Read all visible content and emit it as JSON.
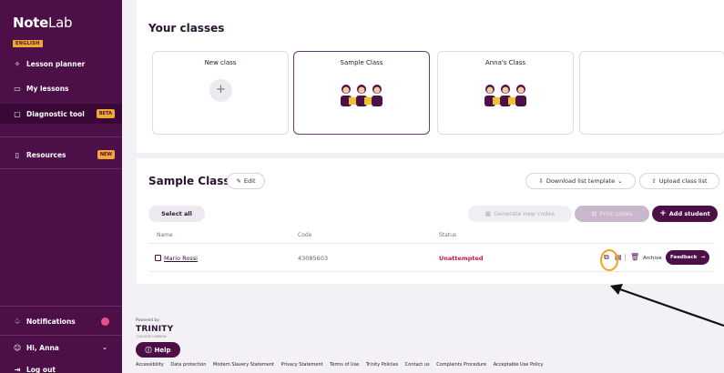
{
  "sidebar": {
    "logo": {
      "main": "Note",
      "light": "Lab",
      "badge": "ENGLISH"
    },
    "items": [
      {
        "label": "Lesson planner",
        "icon": "sparkle-icon"
      },
      {
        "label": "My lessons",
        "icon": "book-icon"
      },
      {
        "label": "Diagnostic tool",
        "icon": "chat-icon",
        "badge": "BETA",
        "active": true
      },
      {
        "label": "Resources",
        "icon": "book-open-icon",
        "badge": "NEW"
      }
    ],
    "bottom": [
      {
        "label": "Notifications",
        "icon": "bell-icon"
      },
      {
        "label": "Hi, Anna",
        "icon": "user-icon"
      },
      {
        "label": "Log out",
        "icon": "logout-icon"
      }
    ]
  },
  "classes": {
    "title": "Your classes",
    "cards": [
      {
        "label": "New class"
      },
      {
        "label": "Sample Class",
        "selected": true
      },
      {
        "label": "Anna's Class"
      },
      {
        "label": ""
      }
    ]
  },
  "class_panel": {
    "title": "Sample Class",
    "edit_label": "Edit",
    "download_label": "Download list template",
    "upload_label": "Upload class list",
    "select_all": "Select all",
    "generate_codes": "Generate new codes",
    "print_codes": "Print codes",
    "add_student": "Add student",
    "columns": [
      "Name",
      "Code",
      "Status"
    ],
    "rows": [
      {
        "name": "Mario Rossi",
        "code": "43085603",
        "status": "Unattempted",
        "archive": "Archive",
        "feedback": "Feedback"
      }
    ]
  },
  "footer": {
    "powered_by": "Powered by",
    "brand": "TRINITY",
    "brand_sub": "COLLEGE LONDON",
    "help": "Help",
    "links": [
      "Accessibility",
      "Data protection",
      "Modern Slavery Statement",
      "Privacy Statement",
      "Terms of Use",
      "Trinity Policies",
      "Contact us",
      "Complaints Procedure",
      "Acceptable Use Policy"
    ]
  },
  "colors": {
    "brand": "#4d0f48",
    "accent": "#f0a830",
    "status_red": "#c0194a",
    "annotation": "#f4a21b"
  }
}
